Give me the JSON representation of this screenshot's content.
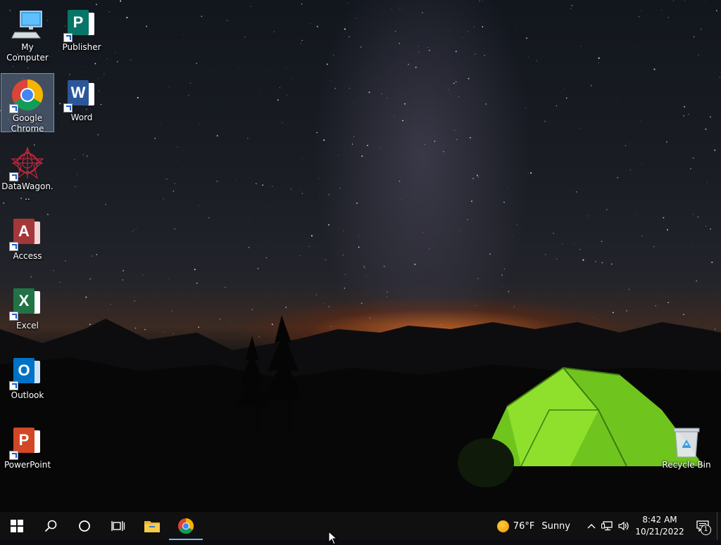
{
  "desktop": {
    "icons": [
      {
        "label": "My Computer",
        "icon": "computer-icon"
      },
      {
        "label": "Publisher",
        "icon": "publisher-icon"
      },
      {
        "label": "Google Chrome",
        "icon": "chrome-icon",
        "selected": true
      },
      {
        "label": "Word",
        "icon": "word-icon"
      },
      {
        "label": "DataWagon...",
        "icon": "datawagon-icon"
      },
      {
        "label": "Access",
        "icon": "access-icon"
      },
      {
        "label": "Excel",
        "icon": "excel-icon"
      },
      {
        "label": "Outlook",
        "icon": "outlook-icon"
      },
      {
        "label": "PowerPoint",
        "icon": "powerpoint-icon"
      },
      {
        "label": "Recycle Bin",
        "icon": "recycle-bin-icon"
      }
    ]
  },
  "taskbar": {
    "buttons": [
      {
        "name": "start",
        "icon": "windows-logo-icon"
      },
      {
        "name": "search",
        "icon": "search-icon"
      },
      {
        "name": "cortana",
        "icon": "cortana-circle-icon"
      },
      {
        "name": "task-view",
        "icon": "task-view-icon"
      },
      {
        "name": "file-explorer",
        "icon": "folder-icon"
      },
      {
        "name": "chrome",
        "icon": "chrome-icon"
      }
    ],
    "weather": {
      "temp": "76°F",
      "condition": "Sunny",
      "icon": "sun-icon"
    },
    "clock": {
      "time": "8:42 AM",
      "date": "10/21/2022"
    },
    "notifications": {
      "count": "1"
    }
  },
  "colors": {
    "taskbar_bg": "#101010",
    "selection": "#96b4dc",
    "chrome_red": "#db4437",
    "chrome_green": "#0f9d58",
    "chrome_yellow": "#f4b400",
    "chrome_blue": "#4285f4"
  }
}
